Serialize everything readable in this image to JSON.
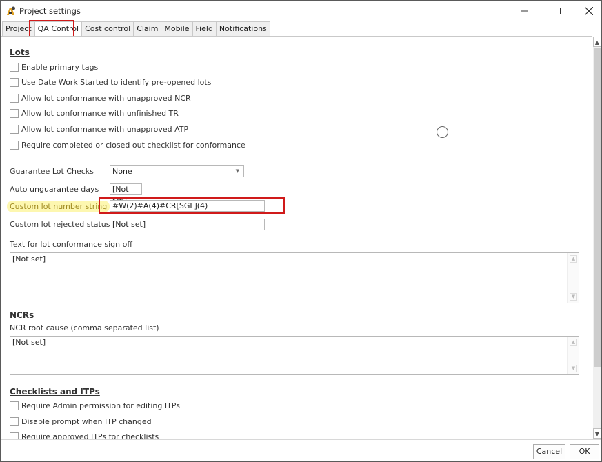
{
  "window": {
    "title": "Project settings",
    "min_glyph": "—",
    "max_glyph": "☐",
    "close_glyph": "✕"
  },
  "tabs": [
    {
      "label": "Project",
      "active": false
    },
    {
      "label": "QA Control",
      "active": true
    },
    {
      "label": "Cost control",
      "active": false
    },
    {
      "label": "Claim",
      "active": false
    },
    {
      "label": "Mobile",
      "active": false
    },
    {
      "label": "Field",
      "active": false
    },
    {
      "label": "Notifications",
      "active": false
    }
  ],
  "lots": {
    "title": "Lots",
    "checkboxes": [
      {
        "label": "Enable primary tags",
        "checked": false
      },
      {
        "label": "Use Date Work Started to identify pre-opened lots",
        "checked": false
      },
      {
        "label": "Allow lot conformance with unapproved NCR",
        "checked": false
      },
      {
        "label": "Allow lot conformance with unfinished TR",
        "checked": false
      },
      {
        "label": "Allow lot conformance with unapproved ATP",
        "checked": false
      },
      {
        "label": "Require completed or closed out checklist for conformance",
        "checked": false
      }
    ],
    "guarantee_label": "Guarantee Lot Checks",
    "guarantee_value": "None",
    "auto_unguarantee_label": "Auto unguarantee days",
    "auto_unguarantee_value": "[Not set]",
    "custom_number_label": "Custom lot number string",
    "custom_number_value": "#W(2)#A(4)#CR[SGL](4)",
    "rejected_status_label": "Custom lot rejected status",
    "rejected_status_value": "[Not set]",
    "signoff_label": "Text for lot conformance sign off",
    "signoff_value": "[Not set]"
  },
  "ncrs": {
    "title": "NCRs",
    "root_cause_label": "NCR root cause (comma separated list)",
    "root_cause_value": "[Not set]"
  },
  "checklists": {
    "title": "Checklists and ITPs",
    "checkboxes": [
      {
        "label": "Require Admin permission for editing ITPs",
        "checked": false
      },
      {
        "label": "Disable prompt when ITP changed",
        "checked": false
      },
      {
        "label": "Require approved ITPs for checklists",
        "checked": false
      }
    ]
  },
  "footer": {
    "cancel_label": "Cancel",
    "ok_label": "OK"
  }
}
